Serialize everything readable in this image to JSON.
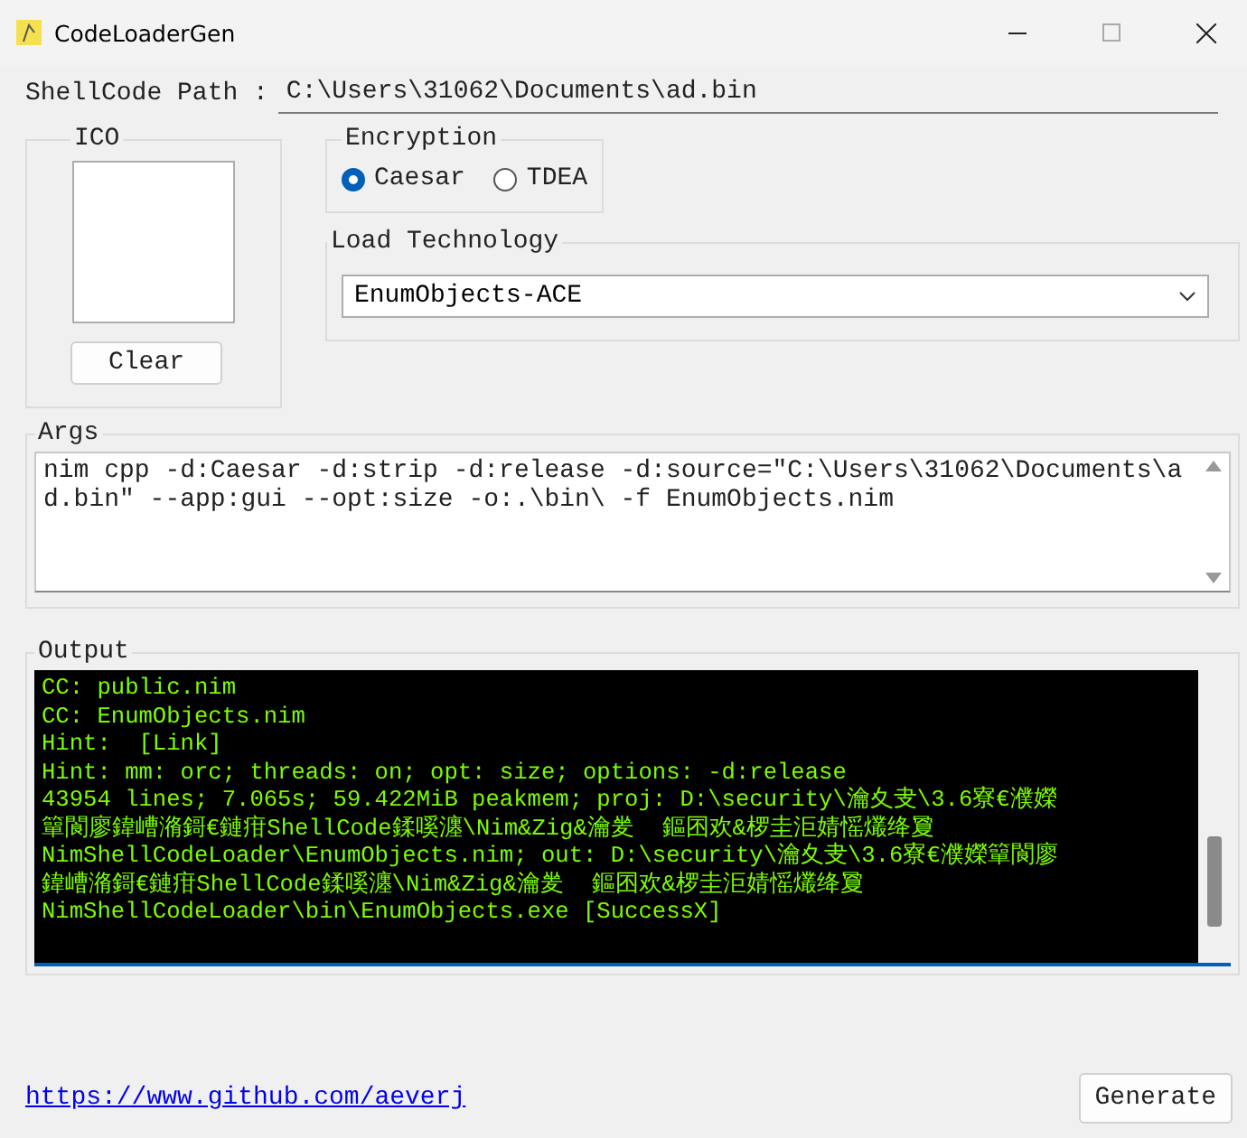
{
  "window": {
    "title": "CodeLoaderGen"
  },
  "shellcode_path": {
    "label": "ShellCode Path :",
    "value": "C:\\Users\\31062\\Documents\\ad.bin"
  },
  "ico": {
    "title": "ICO",
    "button": "Clear"
  },
  "encryption": {
    "title": "Encryption",
    "options": [
      {
        "label": "Caesar",
        "selected": true
      },
      {
        "label": "TDEA",
        "selected": false
      }
    ]
  },
  "load_technology": {
    "title": "Load Technology",
    "value": "EnumObjects-ACE"
  },
  "args": {
    "title": "Args",
    "value": "nim cpp -d:Caesar -d:strip -d:release -d:source=\"C:\\Users\\31062\\Documents\\ad.bin\" --app:gui --opt:size -o:.\\bin\\ -f EnumObjects.nim"
  },
  "output": {
    "title": "Output",
    "lines": [
      "CC: public.nim",
      "CC: EnumObjects.nim",
      "Hint:  [Link]",
      "Hint: mm: orc; threads: on; opt: size; options: -d:release",
      "43954 lines; 7.065s; 59.422MiB peakmem; proj: D:\\security\\瀹夊叏\\3.6寮€濮嬫",
      "簞閬廖鍏嶆潃鎶€鏈疳ShellCode鍒嗘瀍\\Nim&Zig&瀹夎  鏂囨欢&椤圭洰婧愮爜绛夐",
      "NimShellCodeLoader\\EnumObjects.nim; out: D:\\security\\瀹夊叏\\3.6寮€濮嬫簞閬廖",
      "鍏嶆潃鎶€鏈疳ShellCode鍒嗘瀍\\Nim&Zig&瀹夎  鏂囨欢&椤圭洰婧愮爜绛夐",
      "NimShellCodeLoader\\bin\\EnumObjects.exe [SuccessX]"
    ]
  },
  "link": "https://www.github.com/aeverj",
  "generate_button": "Generate"
}
